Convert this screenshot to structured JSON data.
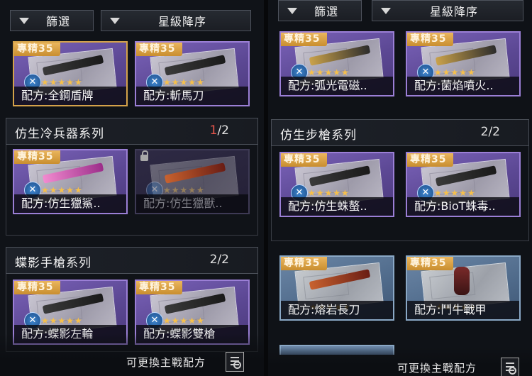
{
  "left": {
    "filter_label": "篩選",
    "sort_label": "星級降序",
    "top_cards": [
      {
        "badge": "專精35",
        "name": "配方:全鋼盾牌",
        "stars": "★★★★★"
      },
      {
        "badge": "專精35",
        "name": "配方:斬馬刀",
        "stars": "★★★★★"
      }
    ],
    "section1": {
      "title": "仿生冷兵器系列",
      "count_current": "1",
      "count_total": "/2",
      "cards": [
        {
          "badge": "專精35",
          "name": "配方:仿生獵鯊..",
          "stars": "★★★★★"
        },
        {
          "badge": "專精35",
          "name": "配方:仿生獵獸..",
          "stars": "★★★★★"
        }
      ]
    },
    "section2": {
      "title": "蝶影手槍系列",
      "count": "2/2",
      "cards": [
        {
          "badge": "專精35",
          "name": "配方:蝶影左輪",
          "stars": "★★★★★"
        },
        {
          "badge": "專精35",
          "name": "配方:蝶影雙槍",
          "stars": "★★★★★"
        }
      ]
    },
    "footer_text": "可更換主戰配方"
  },
  "right": {
    "filter_label": "篩選",
    "sort_label": "星級降序",
    "top_cards": [
      {
        "badge": "專精35",
        "name": "配方:弧光電磁..",
        "stars": "★★★★★"
      },
      {
        "badge": "專精35",
        "name": "配方:菌焰噴火..",
        "stars": "★★★★★"
      }
    ],
    "section1": {
      "title": "仿生步槍系列",
      "count": "2/2",
      "cards": [
        {
          "badge": "專精35",
          "name": "配方:仿生蛛螯..",
          "stars": "★★★★★"
        },
        {
          "badge": "專精35",
          "name": "配方:BioT蛛毒..",
          "stars": "★★★★★"
        }
      ]
    },
    "bottom_cards": [
      {
        "badge": "專精35",
        "name": "配方:熔岩長刀",
        "stars": "★★★★★"
      },
      {
        "badge": "專精35",
        "name": "配方:鬥牛戰甲",
        "stars": "★★★★★"
      }
    ],
    "footer_text": "可更換主戰配方"
  },
  "colors": {
    "card_purple": "#6a54a6",
    "card_blue": "#5a7696",
    "badge_gold": "#dca349",
    "count_highlight": "#e8564b",
    "star": "#f6c04a"
  },
  "icons": [
    "filter-triangle-icon",
    "wrench-icon",
    "lock-icon",
    "recipe-list-icon",
    "star-icon"
  ]
}
